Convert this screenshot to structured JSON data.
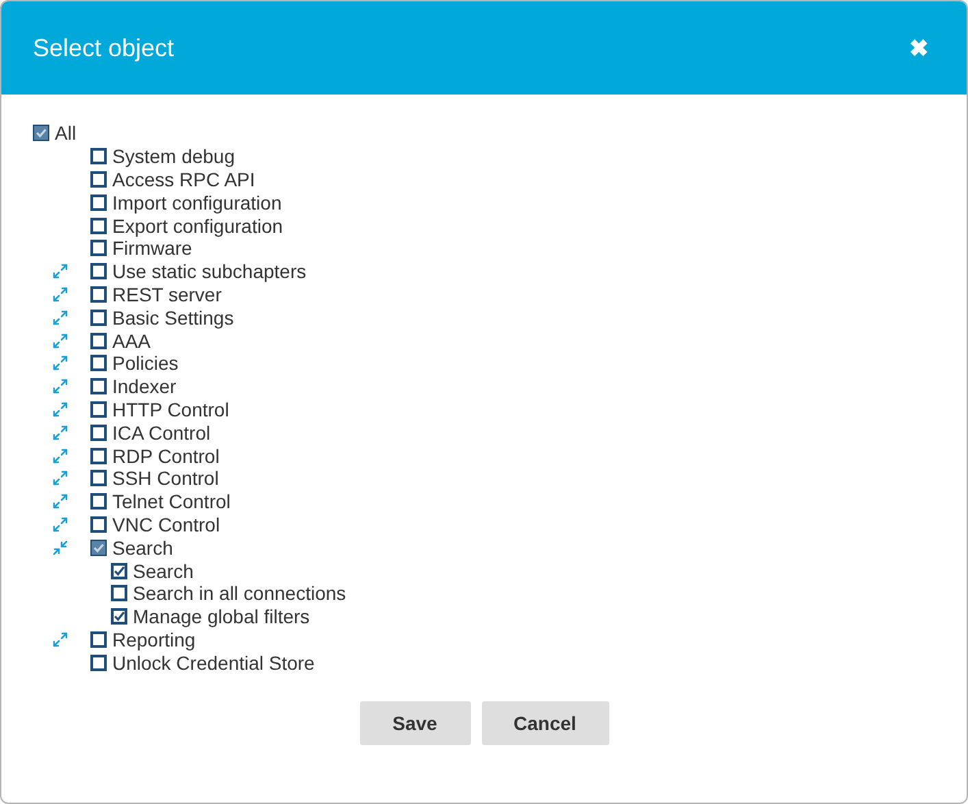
{
  "dialog": {
    "title": "Select object",
    "close_label": "✖"
  },
  "tree": [
    {
      "label": "All",
      "checked": false,
      "indeterminate": true,
      "children": [
        {
          "label": "System debug",
          "checked": false,
          "indeterminate": false
        },
        {
          "label": "Access RPC API",
          "checked": false,
          "indeterminate": false
        },
        {
          "label": "Import configuration",
          "checked": false,
          "indeterminate": false
        },
        {
          "label": "Export configuration",
          "checked": false,
          "indeterminate": false
        },
        {
          "label": "Firmware",
          "checked": false,
          "indeterminate": false
        },
        {
          "label": "Use static subchapters",
          "checked": false,
          "indeterminate": false,
          "expanded": false
        },
        {
          "label": "REST server",
          "checked": false,
          "indeterminate": false,
          "expanded": false
        },
        {
          "label": "Basic Settings",
          "checked": false,
          "indeterminate": false,
          "expanded": false
        },
        {
          "label": "AAA",
          "checked": false,
          "indeterminate": false,
          "expanded": false
        },
        {
          "label": "Policies",
          "checked": false,
          "indeterminate": false,
          "expanded": false
        },
        {
          "label": "Indexer",
          "checked": false,
          "indeterminate": false,
          "expanded": false
        },
        {
          "label": "HTTP Control",
          "checked": false,
          "indeterminate": false,
          "expanded": false
        },
        {
          "label": "ICA Control",
          "checked": false,
          "indeterminate": false,
          "expanded": false
        },
        {
          "label": "RDP Control",
          "checked": false,
          "indeterminate": false,
          "expanded": false
        },
        {
          "label": "SSH Control",
          "checked": false,
          "indeterminate": false,
          "expanded": false
        },
        {
          "label": "Telnet Control",
          "checked": false,
          "indeterminate": false,
          "expanded": false
        },
        {
          "label": "VNC Control",
          "checked": false,
          "indeterminate": false,
          "expanded": false
        },
        {
          "label": "Search",
          "checked": false,
          "indeterminate": true,
          "expanded": true,
          "children": [
            {
              "label": "Search",
              "checked": true,
              "indeterminate": false
            },
            {
              "label": "Search in all connections",
              "checked": false,
              "indeterminate": false
            },
            {
              "label": "Manage global filters",
              "checked": true,
              "indeterminate": false
            }
          ]
        },
        {
          "label": "Reporting",
          "checked": false,
          "indeterminate": false,
          "expanded": false
        },
        {
          "label": "Unlock Credential Store",
          "checked": false,
          "indeterminate": false
        }
      ]
    }
  ],
  "buttons": [
    "Save",
    "Cancel"
  ]
}
